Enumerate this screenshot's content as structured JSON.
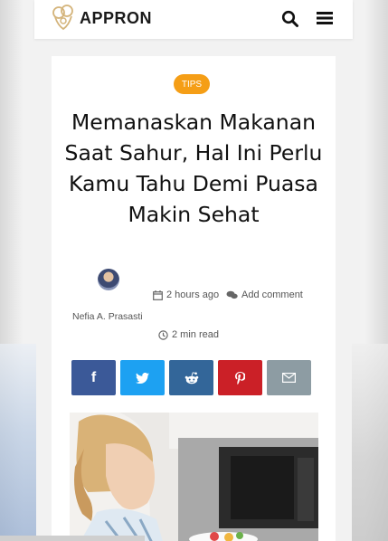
{
  "header": {
    "logo_text": "APPRON",
    "search_icon": "search-icon",
    "menu_icon": "hamburger-menu-icon"
  },
  "article": {
    "category": "TIPS",
    "title": "Memanaskan Makanan Saat Sahur, Hal Ini Perlu Kamu Tahu Demi Puasa Makin Sehat",
    "author": "Nefia A. Prasasti",
    "posted": "2 hours ago",
    "comment_link": "Add comment",
    "read_time": "2 min read"
  },
  "share": {
    "buttons": [
      {
        "network": "facebook",
        "icon": "facebook-icon",
        "glyph": "f",
        "color": "#3b5998"
      },
      {
        "network": "twitter",
        "icon": "twitter-icon",
        "glyph": "",
        "color": "#1da1f2"
      },
      {
        "network": "reddit",
        "icon": "reddit-icon",
        "glyph": "",
        "color": "#336699"
      },
      {
        "network": "pinterest",
        "icon": "pinterest-icon",
        "glyph": "",
        "color": "#cb2027"
      },
      {
        "network": "email",
        "icon": "email-icon",
        "glyph": "",
        "color": "#8d9ca3"
      }
    ]
  },
  "colors": {
    "accent": "#f59e16",
    "text": "#111111"
  }
}
